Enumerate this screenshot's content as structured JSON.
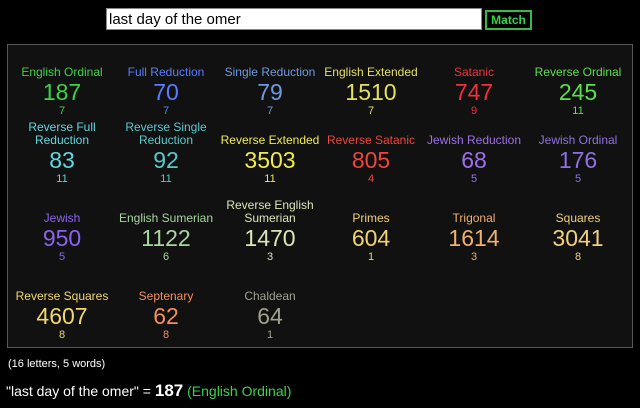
{
  "search": {
    "value": "last day of the omer",
    "button_label": "Match"
  },
  "ciphers": [
    {
      "name": "English Ordinal",
      "value": "187",
      "words": "7",
      "color": "#3cd24a"
    },
    {
      "name": "Full Reduction",
      "value": "70",
      "words": "7",
      "color": "#5a7cff"
    },
    {
      "name": "Single Reduction",
      "value": "79",
      "words": "7",
      "color": "#6e9be0"
    },
    {
      "name": "English Extended",
      "value": "1510",
      "words": "7",
      "color": "#e4e05c"
    },
    {
      "name": "Satanic",
      "value": "747",
      "words": "9",
      "color": "#f0303c"
    },
    {
      "name": "Reverse Ordinal",
      "value": "245",
      "words": "11",
      "color": "#58e04a"
    },
    {
      "name": "Reverse Full Reduction",
      "value": "83",
      "words": "11",
      "color": "#5fd8e0"
    },
    {
      "name": "Reverse Single Reduction",
      "value": "92",
      "words": "11",
      "color": "#5ac8cc"
    },
    {
      "name": "Reverse Extended",
      "value": "3503",
      "words": "11",
      "color": "#f2ec4a"
    },
    {
      "name": "Reverse Satanic",
      "value": "805",
      "words": "4",
      "color": "#f0443c"
    },
    {
      "name": "Jewish Reduction",
      "value": "68",
      "words": "5",
      "color": "#a06ee8"
    },
    {
      "name": "Jewish Ordinal",
      "value": "176",
      "words": "5",
      "color": "#9070e0"
    },
    {
      "name": "Jewish",
      "value": "950",
      "words": "5",
      "color": "#8c62f0"
    },
    {
      "name": "English Sumerian",
      "value": "1122",
      "words": "6",
      "color": "#a8d6a0"
    },
    {
      "name": "Reverse English Sumerian",
      "value": "1470",
      "words": "3",
      "color": "#d8e8b8"
    },
    {
      "name": "Primes",
      "value": "604",
      "words": "1",
      "color": "#f2d272"
    },
    {
      "name": "Trigonal",
      "value": "1614",
      "words": "3",
      "color": "#f0b070"
    },
    {
      "name": "Squares",
      "value": "3041",
      "words": "8",
      "color": "#f0d080"
    },
    {
      "name": "Reverse Squares",
      "value": "4607",
      "words": "8",
      "color": "#f2d66c"
    },
    {
      "name": "Septenary",
      "value": "62",
      "words": "8",
      "color": "#f28f5c"
    },
    {
      "name": "Chaldean",
      "value": "64",
      "words": "1",
      "color": "#a0a08c"
    }
  ],
  "stats": "(16 letters, 5 words)",
  "result": {
    "phrase": "\"last day of the omer\"",
    "equals": " = ",
    "value": "187",
    "cipher": "(English Ordinal)",
    "cipher_color": "#3cd24a"
  }
}
